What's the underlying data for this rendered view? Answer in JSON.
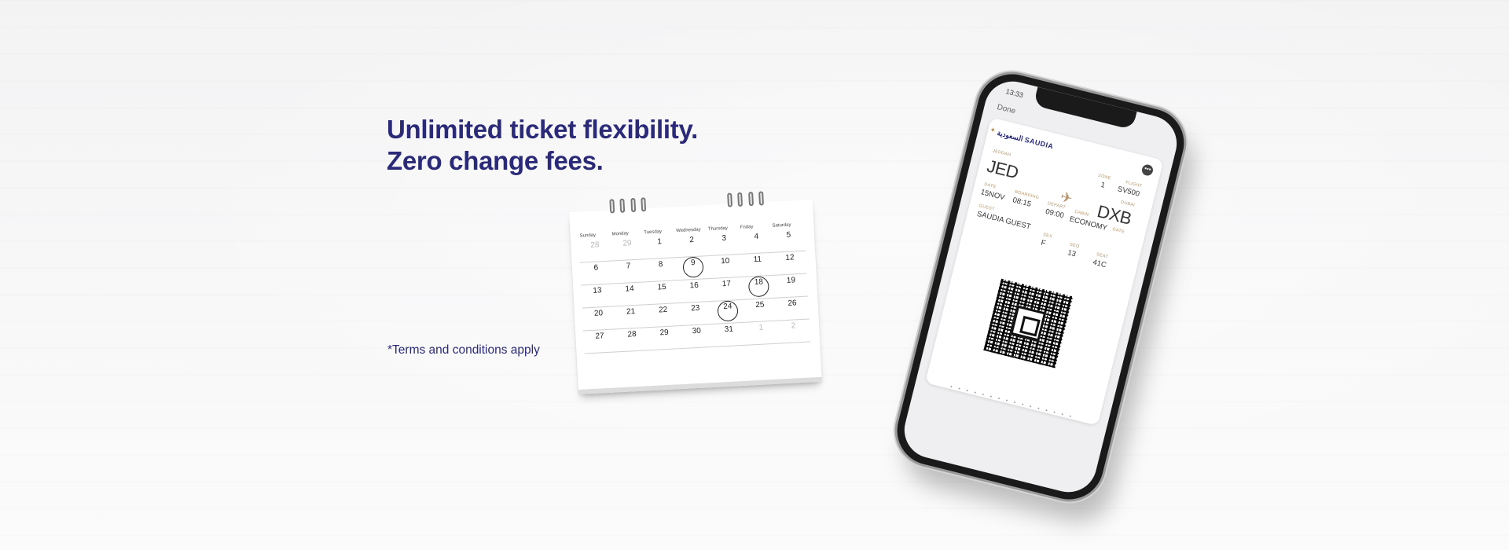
{
  "headline": {
    "line1": "Unlimited ticket flexibility.",
    "line2": "Zero change fees."
  },
  "terms": "*Terms and conditions apply",
  "colors": {
    "brand_text": "#2a2a78",
    "gold_label": "#b4946a"
  },
  "calendar": {
    "days": [
      "Sunday",
      "Monday",
      "Tuesday",
      "Wednesday",
      "Thursday",
      "Friday",
      "Saturday"
    ],
    "rows": [
      [
        "28",
        "29",
        "1",
        "2",
        "3",
        "4",
        "5"
      ],
      [
        "6",
        "7",
        "8",
        "9",
        "10",
        "11",
        "12"
      ],
      [
        "13",
        "14",
        "15",
        "16",
        "17",
        "18",
        "19"
      ],
      [
        "20",
        "21",
        "22",
        "23",
        "24",
        "25",
        "26"
      ],
      [
        "27",
        "28",
        "29",
        "30",
        "31",
        "1",
        "2"
      ]
    ],
    "circled": [
      "9",
      "18",
      "24"
    ]
  },
  "phone": {
    "status_time": "13:33",
    "done_label": "Done",
    "more_icon": "ellipsis-icon",
    "pass": {
      "brand": "SAUDIA",
      "brand_arabic": "السعودية",
      "zone_label": "ZONE",
      "zone": "1",
      "flight_label": "FLIGHT",
      "flight": "SV500",
      "origin_label": "JEDDAH",
      "origin": "JED",
      "destination_label": "DUBAI",
      "destination": "DXB",
      "plane_icon": "airplane-icon",
      "date_label": "DATE",
      "date": "15NOV",
      "boarding_label": "BOARDING",
      "boarding": "08:15",
      "depart_label": "DEPART",
      "depart": "09:00",
      "cabin_label": "CABIN",
      "cabin": "ECONOMY",
      "gate_label": "GATE",
      "guest_label": "GUEST",
      "guest": "SAUDIA GUEST",
      "sex_label": "SEX",
      "sex": "F",
      "seq_label": "SEQ",
      "seq": "13",
      "seat_label": "SEAT",
      "seat": "41C"
    },
    "page_dots": "• • • • • • • • • • • • • • • •"
  }
}
